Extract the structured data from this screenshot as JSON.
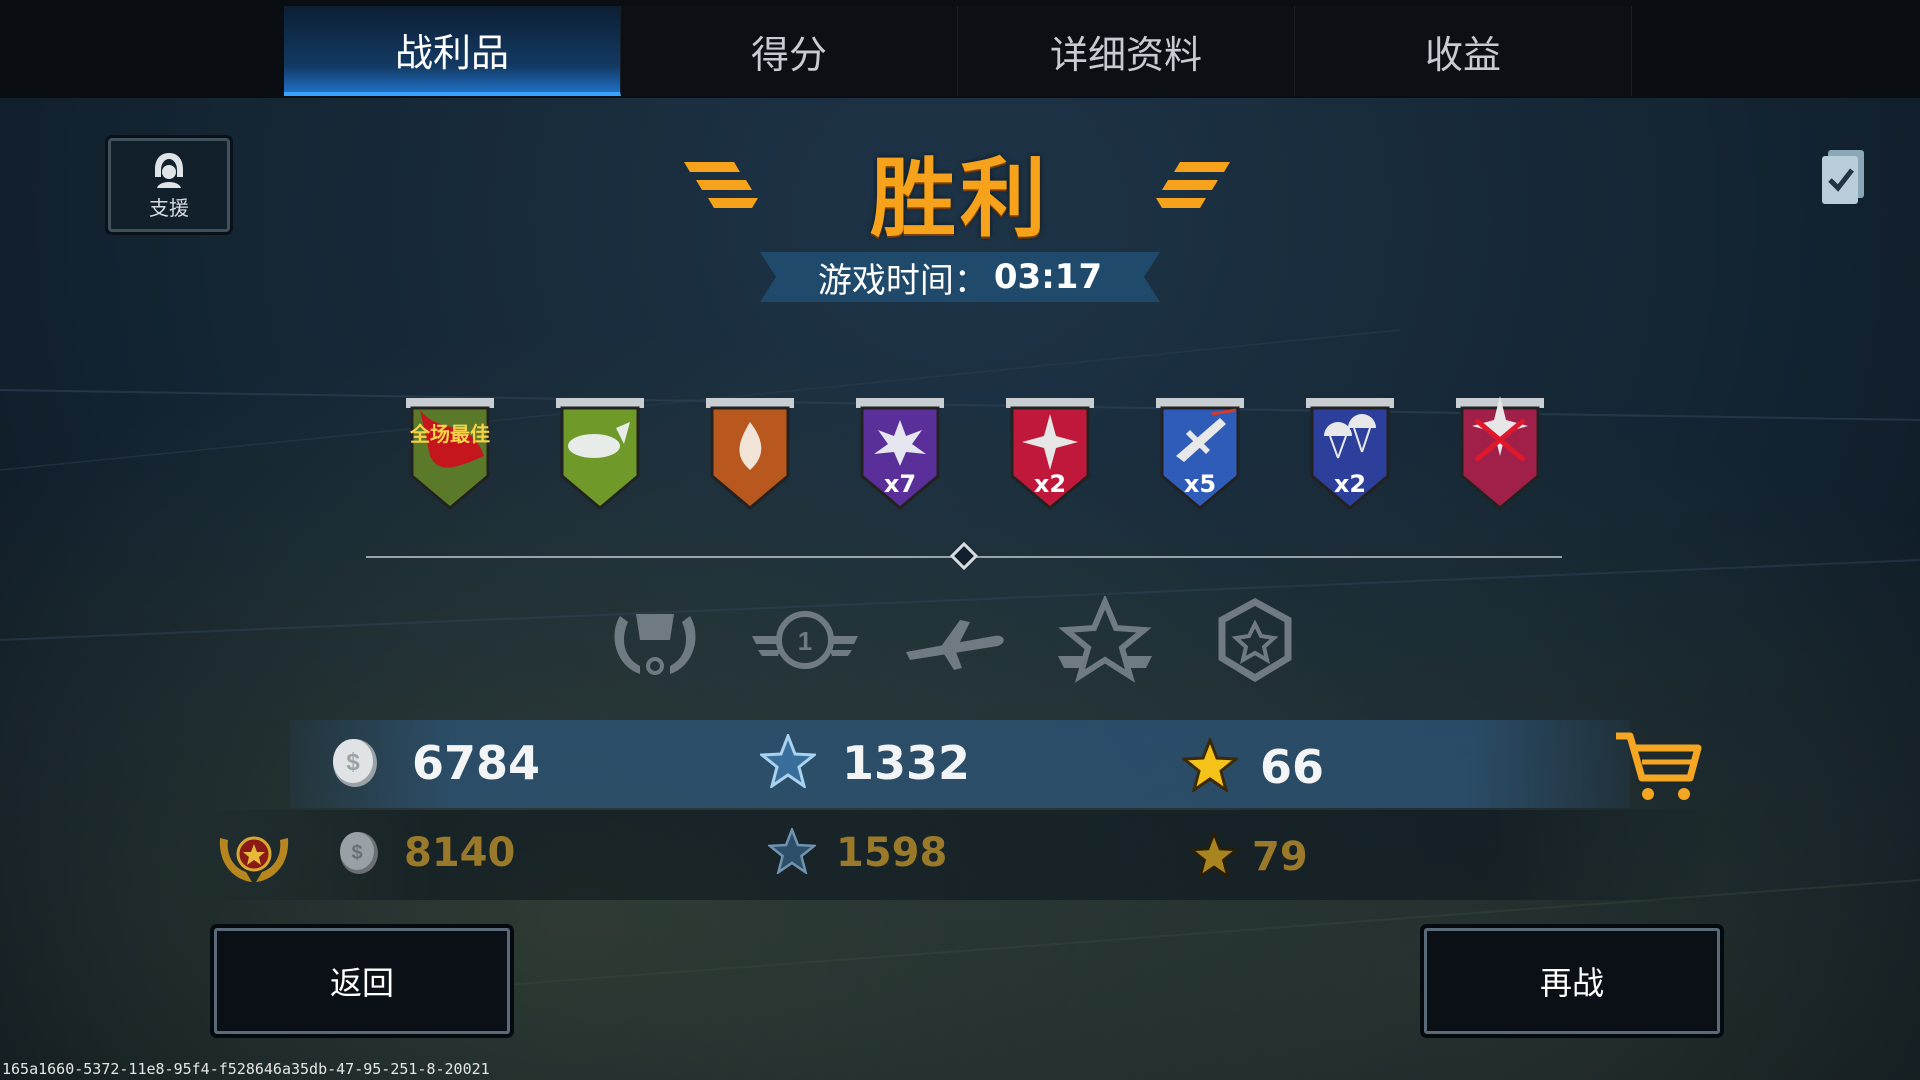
{
  "tabs": [
    {
      "label": "战利品",
      "active": true
    },
    {
      "label": "得分",
      "active": false
    },
    {
      "label": "详细资料",
      "active": false
    },
    {
      "label": "收益",
      "active": false
    }
  ],
  "support": {
    "label": "支援",
    "icon": "pilot-helmet-icon"
  },
  "clipboard_icon": "clipboard-check-icon",
  "result": {
    "title": "胜利",
    "time_label": "游戏时间：",
    "time_value": "03:17"
  },
  "medals": [
    {
      "name": "best-player-medal",
      "text": "全场最佳",
      "multiplier": ""
    },
    {
      "name": "bomb-medal",
      "text": "",
      "multiplier": ""
    },
    {
      "name": "fire-medal",
      "text": "",
      "multiplier": ""
    },
    {
      "name": "explosion-medal",
      "text": "",
      "multiplier": "x7"
    },
    {
      "name": "star-hit-medal",
      "text": "",
      "multiplier": "x2"
    },
    {
      "name": "plane-kill-medal",
      "text": "",
      "multiplier": "x5"
    },
    {
      "name": "parachute-medal",
      "text": "",
      "multiplier": "x2"
    },
    {
      "name": "crossed-star-medal",
      "text": "",
      "multiplier": ""
    }
  ],
  "ranks": [
    "wreath-badge-icon",
    "winged-star-badge-icon",
    "plane-icon",
    "star-banner-icon",
    "hexagon-star-icon"
  ],
  "rewards": {
    "silver": "6784",
    "xp": "1332",
    "gold_stars": "66",
    "premium_silver": "8140",
    "premium_xp": "1598",
    "premium_gold_stars": "79"
  },
  "buttons": {
    "back": "返回",
    "replay": "再战"
  },
  "footer_id": "165a1660-5372-11e8-95f4-f528646a35db-47-95-251-8-20021",
  "colors": {
    "title": "#f6a21a",
    "active_tab": "#1f6fc4",
    "premium_text": "#9a7a2a",
    "cart": "#f5a623"
  }
}
